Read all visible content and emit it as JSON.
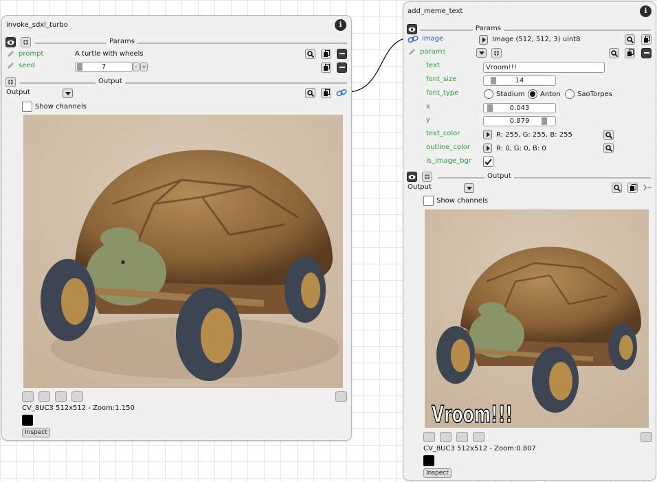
{
  "node_left": {
    "title": "invoke_sdxl_turbo",
    "params_label": "Params",
    "prompt_label": "prompt",
    "prompt_value": "A turtle with wheels",
    "seed_label": "seed",
    "seed_value": "7",
    "output_section_label": "Output",
    "output_label": "Output",
    "show_channels_label": "Show channels",
    "image_info": "CV_8UC3 512x512 - Zoom:1.150",
    "inspect_label": "Inspect"
  },
  "node_right": {
    "title": "add_meme_text",
    "params_label": "Params",
    "image_label": "image",
    "image_value": "Image (512, 512, 3) uint8",
    "params_sub_label": "params",
    "text_label": "text",
    "text_value": "Vroom!!!",
    "font_size_label": "font_size",
    "font_size_value": "14",
    "font_type_label": "font_type",
    "font_options": [
      "Stadium",
      "Anton",
      "SaoTorpes"
    ],
    "font_selected": "Anton",
    "x_label": "x",
    "x_value": "0.043",
    "y_label": "y",
    "y_value": "0.879",
    "text_color_label": "text_color",
    "text_color_value": "R: 255, G: 255, B: 255",
    "outline_color_label": "outline_color",
    "outline_color_value": "R: 0, G: 0, B: 0",
    "is_image_bgr_label": "is_image_bgr",
    "output_section_label": "Output",
    "output_label": "Output",
    "show_channels_label": "Show channels",
    "meme_text": "Vroom!!!",
    "image_info": "CV_8UC3 512x512 - Zoom:0.807",
    "inspect_label": "Inspect"
  },
  "icons": {
    "info": "info-icon",
    "eye": "eye-icon",
    "collapse": "collapse-icon",
    "zoom": "zoom-icon",
    "copy": "copy-icon",
    "minus": "minus-icon",
    "link": "link-icon",
    "pencil": "pencil-icon"
  },
  "colors": {
    "param_green": "#2e9b3e",
    "link_blue": "#2a55c8",
    "shell_dark": "#6b4b2b"
  }
}
